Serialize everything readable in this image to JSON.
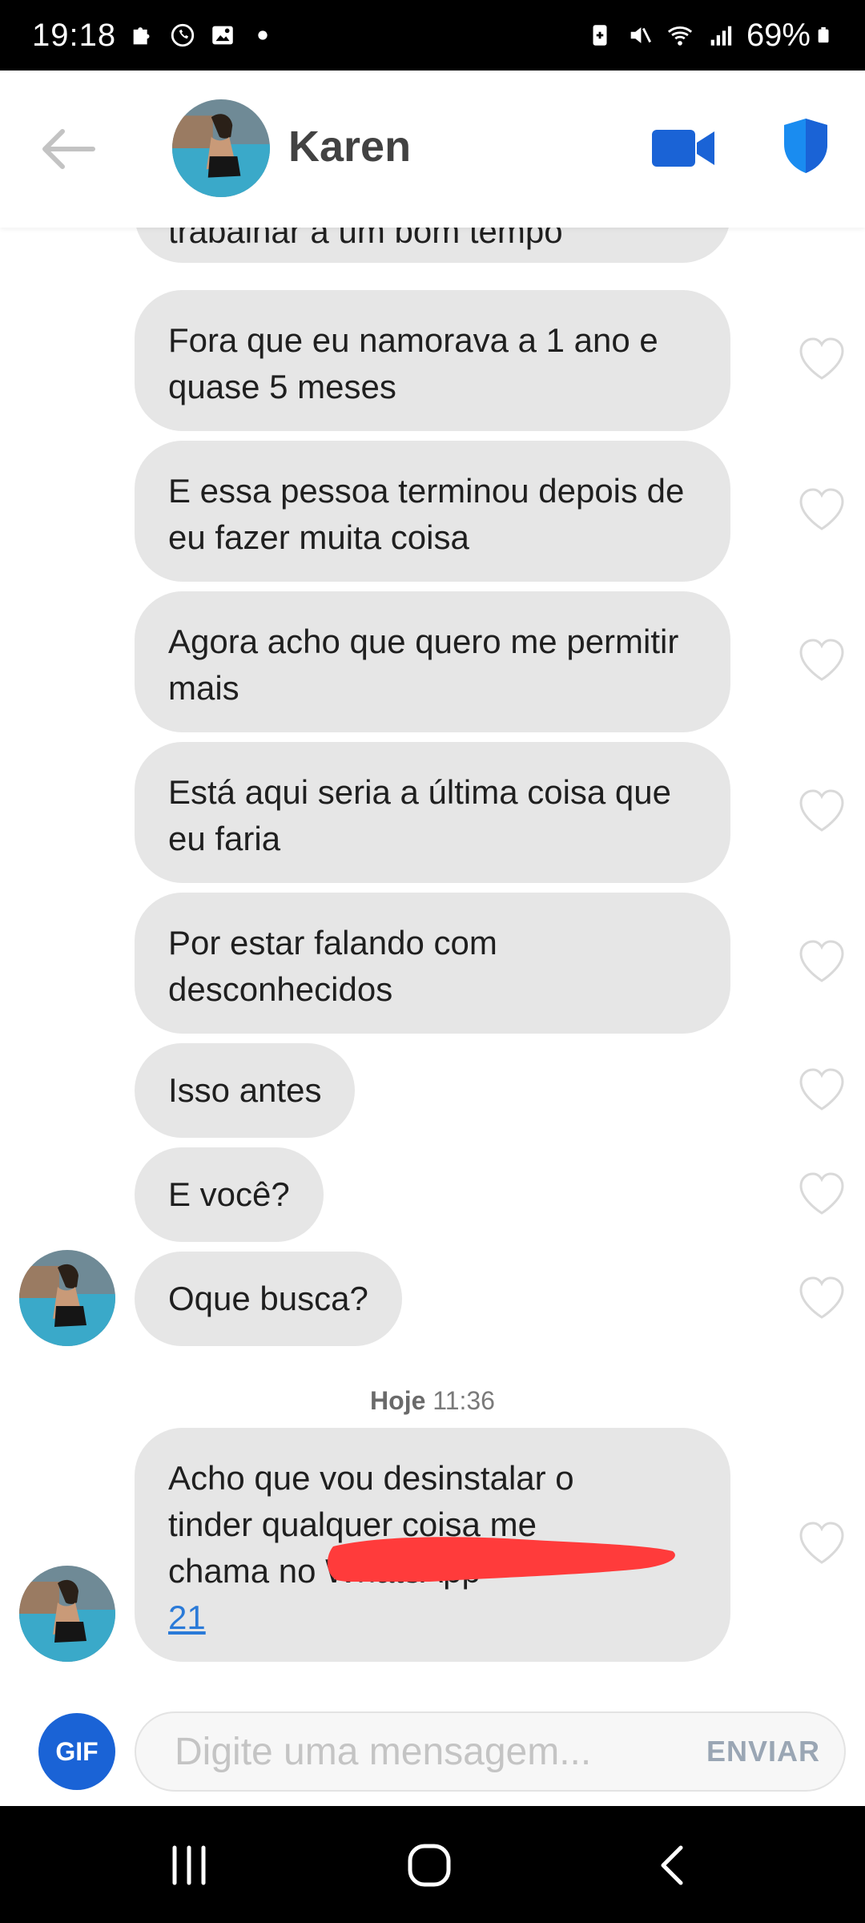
{
  "status_bar": {
    "time": "19:18",
    "battery": "69%"
  },
  "header": {
    "name": "Karen"
  },
  "messages": [
    {
      "text": "trabalhar a um bom tempo"
    },
    {
      "text": "Fora que eu namorava a 1 ano e quase 5 meses"
    },
    {
      "text": "E essa pessoa terminou depois de eu fazer muita coisa"
    },
    {
      "text": "Agora acho que quero me permitir mais"
    },
    {
      "text": "Está aqui seria a última coisa que eu faria"
    },
    {
      "text": "Por estar falando com desconhecidos"
    },
    {
      "text": "Isso antes"
    },
    {
      "text": "E você?"
    },
    {
      "text": "Oque busca?"
    }
  ],
  "timestamp": {
    "day": "Hoje",
    "time": "11:36"
  },
  "last_message": {
    "text": "Acho que vou desinstalar o tinder qualquer coisa me chama no WhatsApp",
    "link": "21"
  },
  "composer": {
    "gif_label": "GIF",
    "placeholder": "Digite uma mensagem...",
    "send_label": "ENVIAR"
  },
  "colors": {
    "accent": "#1a63d6",
    "bubble": "#e6e6e6",
    "redaction": "#ff3b3b"
  }
}
